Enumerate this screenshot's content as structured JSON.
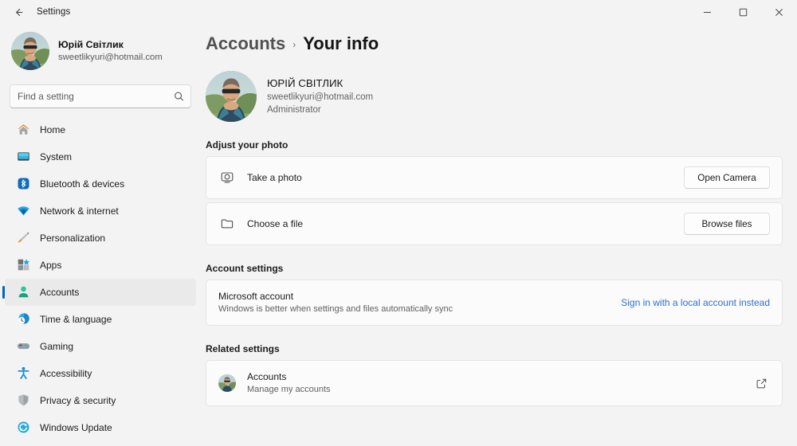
{
  "theme": {
    "accent": "#0067c0",
    "link": "#2f6fd0"
  },
  "titlebar": {
    "back_label": "back-arrow",
    "title": "Settings",
    "minimize": "minimize",
    "maximize": "maximize",
    "close": "close"
  },
  "sidebar": {
    "account": {
      "name": "Юрій Світлик",
      "email": "sweetlikyuri@hotmail.com"
    },
    "search": {
      "placeholder": "Find a setting",
      "value": ""
    },
    "items": [
      {
        "label": "Home",
        "icon": "home-icon",
        "selected": false
      },
      {
        "label": "System",
        "icon": "system-icon",
        "selected": false
      },
      {
        "label": "Bluetooth & devices",
        "icon": "bluetooth-icon",
        "selected": false
      },
      {
        "label": "Network & internet",
        "icon": "network-icon",
        "selected": false
      },
      {
        "label": "Personalization",
        "icon": "personalization-icon",
        "selected": false
      },
      {
        "label": "Apps",
        "icon": "apps-icon",
        "selected": false
      },
      {
        "label": "Accounts",
        "icon": "accounts-icon",
        "selected": true
      },
      {
        "label": "Time & language",
        "icon": "time-icon",
        "selected": false
      },
      {
        "label": "Gaming",
        "icon": "gaming-icon",
        "selected": false
      },
      {
        "label": "Accessibility",
        "icon": "accessibility-icon",
        "selected": false
      },
      {
        "label": "Privacy & security",
        "icon": "privacy-icon",
        "selected": false
      },
      {
        "label": "Windows Update",
        "icon": "update-icon",
        "selected": false
      }
    ]
  },
  "breadcrumb": {
    "parent": "Accounts",
    "separator": "›",
    "current": "Your info"
  },
  "profile": {
    "name": "ЮРІЙ СВІТЛИК",
    "email": "sweetlikyuri@hotmail.com",
    "role": "Administrator"
  },
  "sections": {
    "adjust_photo": {
      "title": "Adjust your photo",
      "rows": [
        {
          "title": "Take a photo",
          "icon": "camera-icon",
          "button": "Open Camera"
        },
        {
          "title": "Choose a file",
          "icon": "folder-icon",
          "button": "Browse files"
        }
      ]
    },
    "account_settings": {
      "title": "Account settings",
      "row": {
        "title": "Microsoft account",
        "subtitle": "Windows is better when settings and files automatically sync",
        "link": "Sign in with a local account instead"
      }
    },
    "related_settings": {
      "title": "Related settings",
      "row": {
        "title": "Accounts",
        "subtitle": "Manage my accounts",
        "icon": "external-link-icon"
      }
    }
  }
}
